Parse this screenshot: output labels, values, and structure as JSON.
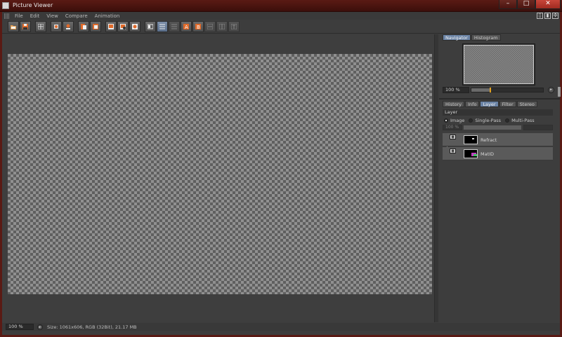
{
  "window": {
    "title": "Picture Viewer",
    "minimize": "–",
    "maximize": "□",
    "close": "✕"
  },
  "menu": [
    "File",
    "Edit",
    "View",
    "Compare",
    "Animation"
  ],
  "layout_icons": [
    "layout-panel-icon",
    "layout-split-icon",
    "move-icon"
  ],
  "toolbar": {
    "buttons": [
      {
        "name": "open-file-icon"
      },
      {
        "name": "save-file-icon"
      },
      {
        "name": "grid-toggle-icon"
      },
      {
        "name": "fit-view-icon"
      },
      {
        "name": "render-snapshot-icon"
      },
      {
        "name": "copy-icon"
      },
      {
        "name": "paste-icon"
      },
      {
        "name": "stop-render-icon"
      },
      {
        "name": "render-region-icon"
      },
      {
        "name": "render-settings-icon"
      },
      {
        "name": "single-view-icon",
        "active": true
      },
      {
        "name": "split-view-icon",
        "active": true
      },
      {
        "name": "split-view-alt-icon"
      },
      {
        "name": "compare-a-icon"
      },
      {
        "name": "compare-b-icon"
      },
      {
        "name": "swap-ab-icon"
      },
      {
        "name": "diff-icon"
      },
      {
        "name": "text-overlay-icon"
      }
    ],
    "accent": "#e06a2a"
  },
  "navigator": {
    "tabs": [
      "Navigator",
      "Histogram"
    ],
    "active_tab": "Navigator",
    "zoom": "100 %",
    "zoom_slider_fraction": 0.25
  },
  "panel": {
    "tabs": [
      "History",
      "Info",
      "Layer",
      "Filter",
      "Stereo"
    ],
    "active_tab": "Layer",
    "section_title": "Layer",
    "modes": [
      {
        "label": "Image",
        "selected": true
      },
      {
        "label": "Single-Pass",
        "selected": false
      },
      {
        "label": "Multi-Pass",
        "selected": false
      }
    ],
    "opacity": "100 %",
    "layers": [
      {
        "name": "Refract",
        "visible": true
      },
      {
        "name": "MatID",
        "visible": true
      }
    ]
  },
  "status": {
    "zoom": "100 %",
    "info": "Size: 1061x606, RGB (32Bit), 21.17 MB"
  },
  "colors": {
    "title_bar": "#5a1a14",
    "selection": "#6b84a6",
    "accent": "#e06a2a"
  }
}
